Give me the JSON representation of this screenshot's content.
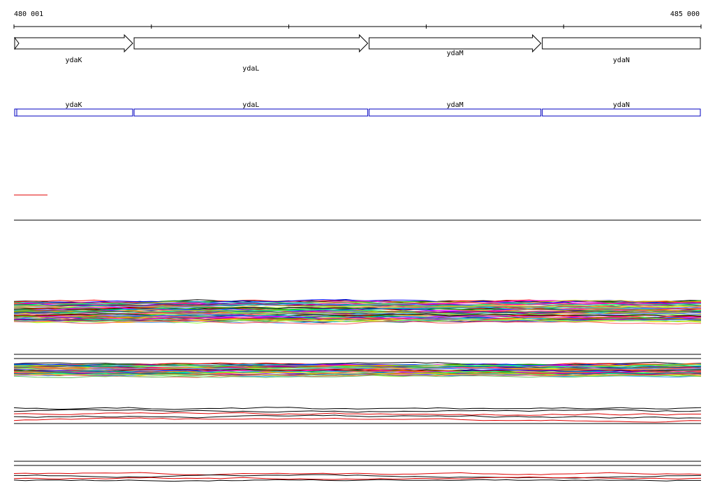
{
  "coordinates": {
    "start_label": "480 001",
    "end_label": "485 000"
  },
  "genes": [
    {
      "name": "ydaK",
      "start": 480001,
      "end": 480870
    },
    {
      "name": "ydaL",
      "start": 480870,
      "end": 482580
    },
    {
      "name": "ydaM",
      "start": 482580,
      "end": 483840
    },
    {
      "name": "ydaN",
      "start": 483840,
      "end": 485000
    }
  ],
  "transcripts": [
    {
      "name": "ydaK",
      "start": 480001,
      "end": 480870
    },
    {
      "name": "ydaL",
      "start": 480870,
      "end": 482580
    },
    {
      "name": "ydaM",
      "start": 482580,
      "end": 483840
    },
    {
      "name": "ydaN",
      "start": 483840,
      "end": 485000
    }
  ],
  "colors": {
    "gene_outline": "#000000",
    "transcript_outline": "#0000c0",
    "highlight_line": "#e00000",
    "track_border": "#000000"
  },
  "expression_tracks": [
    {
      "id": "track-many-1",
      "line_count": 60
    },
    {
      "id": "track-many-2",
      "line_count": 40
    },
    {
      "id": "track-few-1",
      "line_count": 5
    },
    {
      "id": "track-few-2",
      "line_count": 4
    }
  ]
}
